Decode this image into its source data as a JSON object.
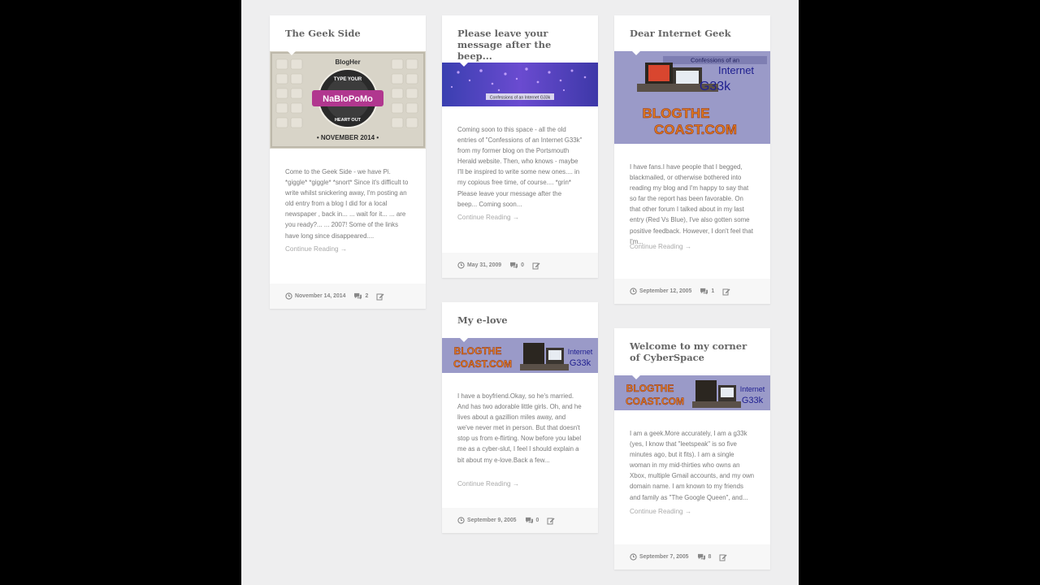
{
  "colors": {
    "page_bg": "#eeeeef",
    "card_bg": "#ffffff",
    "title": "#666666",
    "excerpt": "#7a7a7a",
    "link": "#aaaaaa",
    "meta_bg": "#f7f7f7"
  },
  "posts": [
    {
      "title": "The Geek Side",
      "thumb": {
        "kind": "badge",
        "brand": "BlogHer",
        "ring_top": "TYPE YOUR",
        "ring_bottom": "HEART OUT",
        "banner": "NaBloPoMo",
        "caption": "• NOVEMBER 2014 •"
      },
      "excerpt": "Come to the Geek Side - we have Pi. *giggle* *giggle* *snort* Since it's difficult to write whilst snickering away, I'm posting an old entry from a blog I did for a local newspaper , back in... ... wait for it... ... are you ready?... ... 2007! Some of the links have long since disappeared....",
      "continue": "Continue Reading →",
      "date": "November 14, 2014",
      "comments": "2",
      "date_icon": "clock-icon",
      "comments_icon": "comments-icon",
      "edit_icon": "edit-icon"
    },
    {
      "title": "Please leave your message after the beep...",
      "thumb": {
        "kind": "banner-purple",
        "caption": "Confessions of an Internet G33k"
      },
      "excerpt": "Coming soon to this space - all the old entries of \"Confessions of an Internet G33k\" from my former blog on the Portsmouth Herald website.  Then, who knows - maybe I'll be inspired to write some new ones.... in my copious free time, of course.... *grin* Please leave your message after the beep... Coming soon...",
      "continue": "Continue Reading →",
      "date": "May 31, 2009",
      "comments": "0"
    },
    {
      "title": "Dear Internet Geek",
      "thumb": {
        "kind": "logo-square",
        "line1": "Confessions of an",
        "line2": "Internet",
        "line3": "G33k",
        "brand1": "BLOGTHE",
        "brand2": "COAST.COM"
      },
      "excerpt": "I have fans.I have people that I begged, blackmailed, or otherwise bothered into reading my blog and I'm happy to say that so far the report has been favorable. On that other forum I talked about in my last entry (Red Vs Blue), I've also gotten some positive feedback. However, I don't feel that I'm...",
      "continue": "Continue Reading →",
      "date": "September 12, 2005",
      "comments": "1"
    },
    {
      "title": "My e-love",
      "thumb": {
        "kind": "logo-banner",
        "brand1": "BLOGTHE",
        "brand2": "COAST.COM",
        "line2": "Internet",
        "line3": "G33k"
      },
      "excerpt": "I have a boyfriend.Okay, so he's married. And has two adorable little girls. Oh, and he lives about a gazillion miles away, and we've never met in person. But that doesn't stop us from e-flirting. Now before you label me as a cyber-slut, I feel I should explain a bit about my e-love.Back a few...",
      "continue": "Continue Reading →",
      "date": "September 9, 2005",
      "comments": "0"
    },
    {
      "title": "Welcome to my corner of CyberSpace",
      "thumb": {
        "kind": "logo-banner",
        "brand1": "BLOGTHE",
        "brand2": "COAST.COM",
        "line2": "Internet",
        "line3": "G33k"
      },
      "excerpt": "I am a geek.More accurately, I am a g33k (yes, I know that \"leetspeak\" is so five minutes ago, but it fits). I am a single woman in my mid-thirties who owns an Xbox, multiple Gmail accounts, and my own domain name. I am known to my friends and family as \"The Google Queen\", and...",
      "continue": "Continue Reading →",
      "date": "September 7, 2005",
      "comments": "8"
    }
  ]
}
